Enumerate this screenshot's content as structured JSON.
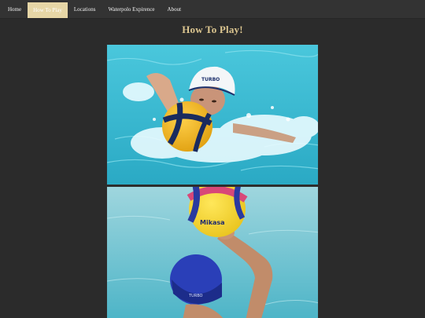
{
  "nav": {
    "items": [
      {
        "label": "Home",
        "active": false
      },
      {
        "label": "How To Play",
        "active": true
      },
      {
        "label": "Locations",
        "active": false
      },
      {
        "label": "Waterpolo Expirence",
        "active": false
      },
      {
        "label": "About",
        "active": false
      }
    ]
  },
  "page": {
    "title": "How To Play!"
  },
  "images": {
    "photo1": {
      "cap_text": "TURBO"
    },
    "photo2": {
      "ball_text": "Mikasa",
      "cap_text": "TURBO"
    }
  },
  "colors": {
    "nav_bg": "#333333",
    "active_tab": "#e6d6a6",
    "title": "#dcc690",
    "page_bg": "#2b2b2b",
    "water": "#2fb7d0"
  }
}
